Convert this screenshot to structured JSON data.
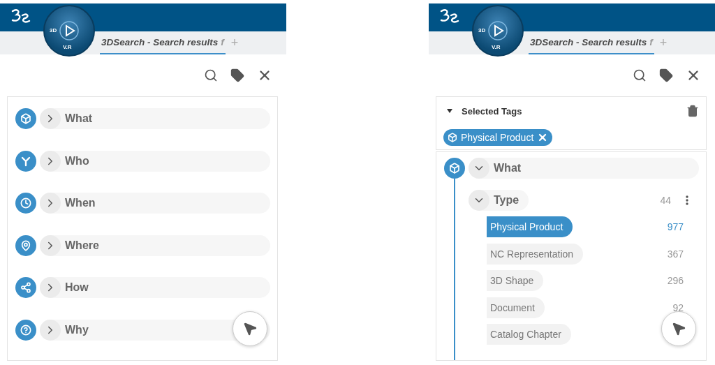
{
  "panels": [
    {
      "header": {
        "compass": {
          "left": "3D",
          "bottom": "V.R"
        },
        "tab": {
          "label": "3DSearch - Search results",
          "fade": "f",
          "selected": true
        },
        "add_tab": "+"
      },
      "categories": [
        {
          "kind": "what",
          "label": "What",
          "expanded": false
        },
        {
          "kind": "who",
          "label": "Who",
          "expanded": false
        },
        {
          "kind": "when",
          "label": "When",
          "expanded": false
        },
        {
          "kind": "where",
          "label": "Where",
          "expanded": false
        },
        {
          "kind": "how",
          "label": "How",
          "expanded": false
        },
        {
          "kind": "why",
          "label": "Why",
          "expanded": false
        }
      ]
    },
    {
      "header": {
        "compass": {
          "left": "3D",
          "bottom": "V.R"
        },
        "tab": {
          "label": "3DSearch - Search results",
          "fade": "f",
          "selected": true
        },
        "add_tab": "+"
      },
      "selected_tags": {
        "title": "Selected Tags",
        "expanded": true,
        "tags": [
          {
            "kind": "what",
            "label": "Physical Product"
          }
        ]
      },
      "categories": [
        {
          "kind": "what",
          "label": "What",
          "expanded": true,
          "children": [
            {
              "label": "Type",
              "count": "44",
              "expanded": true,
              "children": [
                {
                  "label": "Physical Product",
                  "count": "977",
                  "selected": true
                },
                {
                  "label": "NC Representation",
                  "count": "367",
                  "selected": false
                },
                {
                  "label": "3D Shape",
                  "count": "296",
                  "selected": false
                },
                {
                  "label": "Document",
                  "count": "92",
                  "selected": false
                },
                {
                  "label": "Catalog Chapter",
                  "selected": false
                }
              ]
            }
          ]
        }
      ]
    }
  ]
}
